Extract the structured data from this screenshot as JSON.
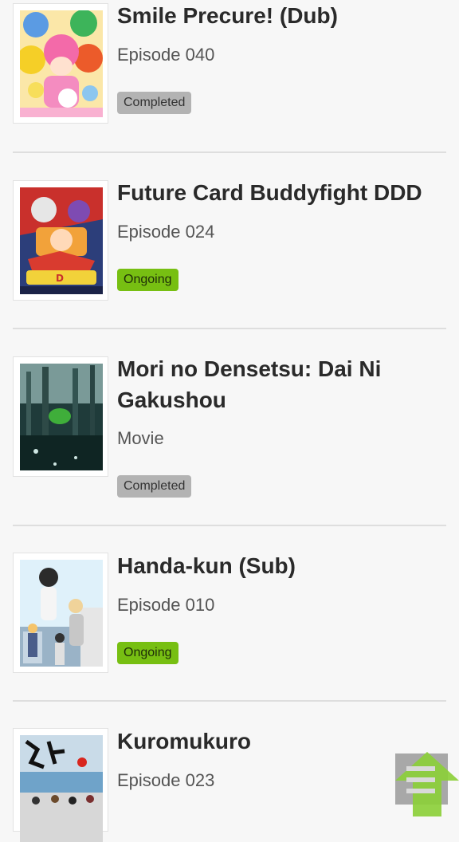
{
  "items": [
    {
      "title": "Smile Precure! (Dub)",
      "episode": "Episode 040",
      "status": "Completed"
    },
    {
      "title": "Future Card Buddyfight DDD",
      "episode": "Episode 024",
      "status": "Ongoing"
    },
    {
      "title": "Mori no Densetsu: Dai Ni Gakushou",
      "episode": "Movie",
      "status": "Completed"
    },
    {
      "title": "Handa-kun (Sub)",
      "episode": "Episode 010",
      "status": "Ongoing"
    },
    {
      "title": "Kuromukuro",
      "episode": "Episode 023",
      "status": ""
    }
  ],
  "colors": {
    "completed_badge": "#b3b3b3",
    "ongoing_badge": "#77bf12",
    "scroll_top_button": "#8ccf3a"
  },
  "icons": {
    "scroll_top": "arrow-up-icon"
  }
}
